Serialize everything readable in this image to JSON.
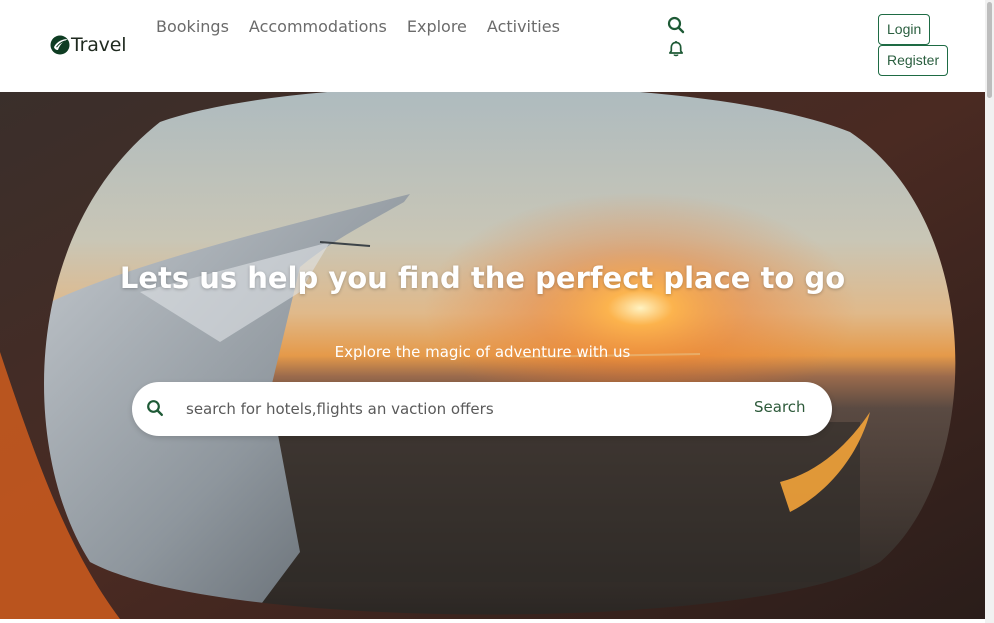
{
  "brand": {
    "name": "Travel",
    "logo_icon": "leaf-swirl-logo-icon"
  },
  "nav": {
    "items": [
      {
        "label": "Bookings"
      },
      {
        "label": "Accommodations"
      },
      {
        "label": "Explore"
      },
      {
        "label": "Activities"
      }
    ]
  },
  "header_icons": [
    "search-icon",
    "bell-icon"
  ],
  "auth": {
    "login_label": "Login",
    "register_label": "Register"
  },
  "hero": {
    "title": "Lets us help you find the perfect place to go",
    "subtitle": "Explore the magic of adventure with us",
    "background": "airplane-window-sunset-wing-photo"
  },
  "search": {
    "placeholder": "search for hotels,flights an vaction offers",
    "value": "",
    "button_label": "Search"
  },
  "colors": {
    "accent": "#1e6b44",
    "nav_text": "#6b6b6b",
    "hero_text": "#ffffff",
    "search_button_text": "#2d5a3a"
  }
}
